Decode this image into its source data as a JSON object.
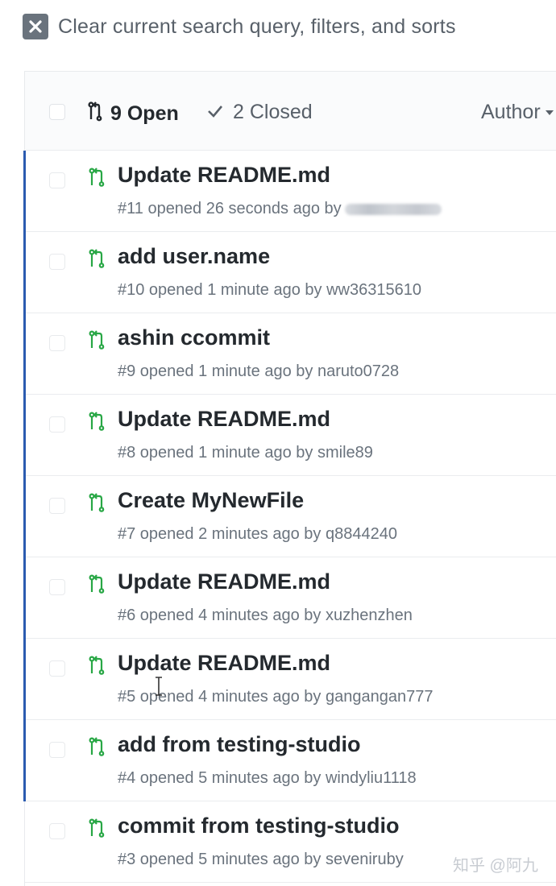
{
  "clear_bar": {
    "label": "Clear current search query, filters, and sorts"
  },
  "header": {
    "open_label": "9 Open",
    "closed_label": "2 Closed",
    "author_label": "Author"
  },
  "pull_requests": [
    {
      "title": "Update README.md",
      "meta": "#11 opened 26 seconds ago by"
    },
    {
      "title": "add user.name",
      "meta": "#10 opened 1 minute ago by ww36315610"
    },
    {
      "title": "ashin ccommit",
      "meta": "#9 opened 1 minute ago by naruto0728"
    },
    {
      "title": "Update README.md",
      "meta": "#8 opened 1 minute ago by smile89"
    },
    {
      "title": "Create MyNewFile",
      "meta": "#7 opened 2 minutes ago by q8844240"
    },
    {
      "title": "Update README.md",
      "meta": "#6 opened 4 minutes ago by xuzhenzhen"
    },
    {
      "title": "Update README.md",
      "meta": "#5 opened 4 minutes ago by gangangan777"
    },
    {
      "title": "add from testing-studio",
      "meta": "#4 opened 5 minutes ago by windyliu1118"
    },
    {
      "title": "commit from testing-studio",
      "meta": "#3 opened 5 minutes ago by seveniruby"
    }
  ],
  "watermark": "知乎 @阿九",
  "colors": {
    "pr_open_icon": "#28a745",
    "selection_bar": "#2b5bb0",
    "muted_text": "#6a737d"
  },
  "icons": {
    "clear": "close-icon",
    "pull_request": "git-pull-request-icon",
    "closed": "check-icon",
    "sort": "caret-down-icon"
  }
}
